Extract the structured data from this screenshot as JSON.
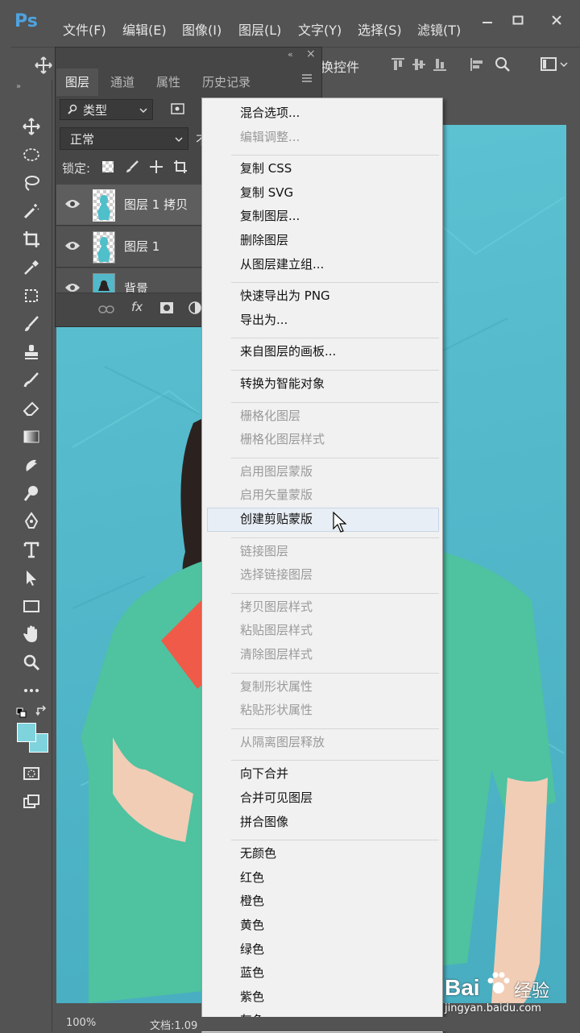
{
  "app": {
    "logo": "Ps"
  },
  "menubar": {
    "items": [
      "文件(F)",
      "编辑(E)",
      "图像(I)",
      "图层(L)",
      "文字(Y)",
      "选择(S)",
      "滤镜(T)"
    ]
  },
  "options_bar": {
    "label": "换控件"
  },
  "layers_panel": {
    "tabs": [
      "图层",
      "通道",
      "属性",
      "历史记录"
    ],
    "filter_label": "类型",
    "blend_mode": "正常",
    "lock_label": "锁定:",
    "layers": [
      {
        "name": "图层 1 拷贝"
      },
      {
        "name": "图层 1"
      },
      {
        "name": "背景"
      }
    ],
    "fx_label": "fx"
  },
  "context_menu": {
    "groups": [
      [
        "混合选项...",
        "编辑调整..."
      ],
      [
        "复制 CSS",
        "复制 SVG",
        "复制图层...",
        "删除图层",
        "从图层建立组..."
      ],
      [
        "快速导出为 PNG",
        "导出为..."
      ],
      [
        "来自图层的画板..."
      ],
      [
        "转换为智能对象"
      ],
      [
        "栅格化图层",
        "栅格化图层样式"
      ],
      [
        "启用图层蒙版",
        "启用矢量蒙版",
        "创建剪贴蒙版"
      ],
      [
        "链接图层",
        "选择链接图层"
      ],
      [
        "拷贝图层样式",
        "粘贴图层样式",
        "清除图层样式"
      ],
      [
        "复制形状属性",
        "粘贴形状属性"
      ],
      [
        "从隔离图层释放"
      ],
      [
        "向下合并",
        "合并可见图层",
        "拼合图像"
      ],
      [
        "无颜色",
        "红色",
        "橙色",
        "黄色",
        "绿色",
        "蓝色",
        "紫色",
        "灰色"
      ]
    ],
    "disabled": [
      "编辑调整...",
      "栅格化图层",
      "栅格化图层样式",
      "启用图层蒙版",
      "启用矢量蒙版",
      "链接图层",
      "选择链接图层",
      "拷贝图层样式",
      "粘贴图层样式",
      "清除图层样式",
      "复制形状属性",
      "粘贴形状属性",
      "从隔离图层释放"
    ],
    "hovered": "创建剪贴蒙版"
  },
  "status_bar": {
    "zoom": "100%",
    "doc": "文档:1.09"
  },
  "watermark": {
    "brand": "Bai",
    "brand2": "经验",
    "url": "jingyan.baidu.com"
  },
  "colors": {
    "accent": "#4ea3e0",
    "canvas_bg": "#52b8ca",
    "foreground_swatch": "#7fd3dd"
  }
}
